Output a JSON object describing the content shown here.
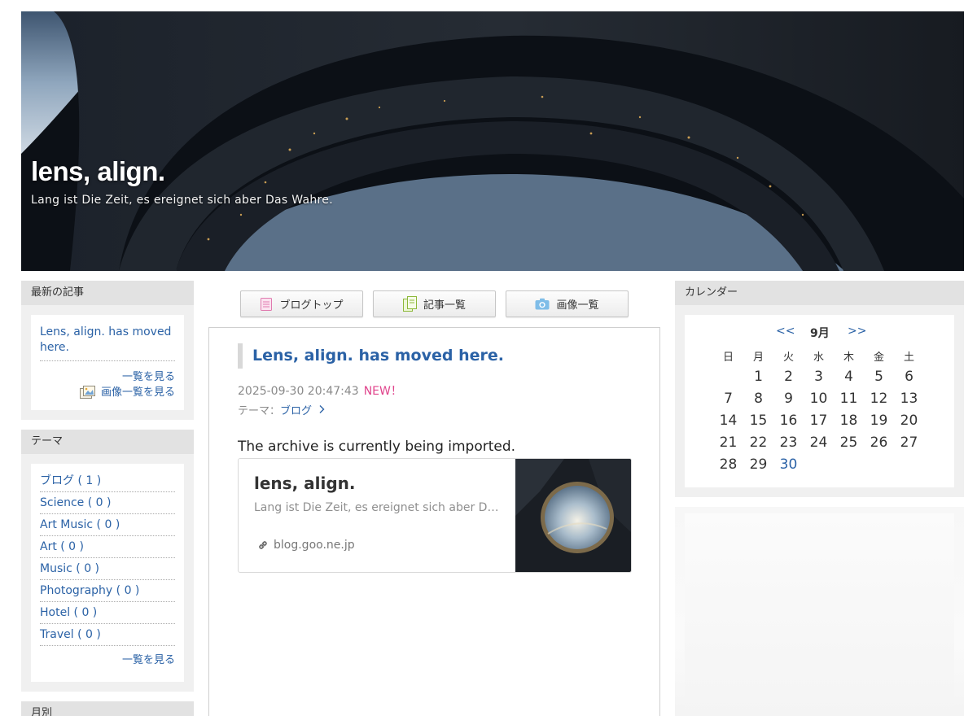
{
  "header": {
    "title": "lens, align.",
    "subtitle": "Lang ist Die Zeit, es ereignet sich aber Das Wahre."
  },
  "left": {
    "recent": {
      "heading": "最新の記事",
      "link": "Lens, align. has moved here.",
      "more": "一覧を見る",
      "images": "画像一覧を見る"
    },
    "theme": {
      "heading": "テーマ",
      "items": [
        "ブログ ( 1 )",
        "Science ( 0 )",
        "Art Music ( 0 )",
        "Art ( 0 )",
        "Music ( 0 )",
        "Photography ( 0 )",
        "Hotel ( 0 )",
        "Travel ( 0 )"
      ],
      "more": "一覧を見る"
    },
    "monthly": {
      "heading": "月別"
    }
  },
  "nav": {
    "blogtop": "ブログトップ",
    "articles": "記事一覧",
    "images": "画像一覧"
  },
  "post": {
    "title": "Lens, align. has moved here.",
    "date": "2025-09-30 20:47:43",
    "new_badge": "NEW！",
    "theme_label": "テーマ：",
    "theme_link": "ブログ",
    "body": "The archive is currently being imported.",
    "card": {
      "title": "lens, align.",
      "description": "Lang ist Die Zeit, es ereignet sich aber Das Wahre.",
      "url": "blog.goo.ne.jp"
    }
  },
  "calendar": {
    "heading": "カレンダー",
    "prev": "<<",
    "month": "9月",
    "next": ">>",
    "weekdays": [
      "日",
      "月",
      "火",
      "水",
      "木",
      "金",
      "土"
    ],
    "weeks": [
      [
        "",
        "1",
        "2",
        "3",
        "4",
        "5",
        "6"
      ],
      [
        "7",
        "8",
        "9",
        "10",
        "11",
        "12",
        "13"
      ],
      [
        "14",
        "15",
        "16",
        "17",
        "18",
        "19",
        "20"
      ],
      [
        "21",
        "22",
        "23",
        "24",
        "25",
        "26",
        "27"
      ],
      [
        "28",
        "29",
        "30",
        "",
        "",
        "",
        ""
      ]
    ],
    "highlighted_day": "30"
  },
  "colors": {
    "link": "#2b62a6",
    "new_badge": "#e0448c",
    "sidebar_head": "#e2e2e2",
    "sidebar_bg": "#f0f0f0"
  }
}
